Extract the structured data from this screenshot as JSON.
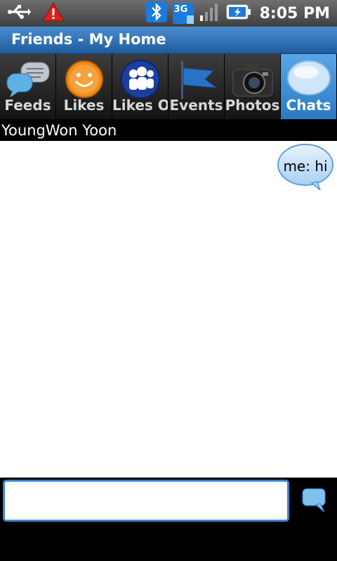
{
  "status_bar": {
    "time": "8:05 PM",
    "network_badge": "3G",
    "icons": [
      "usb-icon",
      "warning-icon",
      "bluetooth-icon",
      "network-3g-icon",
      "signal-icon",
      "battery-charging-icon"
    ]
  },
  "app": {
    "title": "Friends - My Home"
  },
  "tabs": [
    {
      "label": "Feeds",
      "icon": "speech-bubbles-icon"
    },
    {
      "label": "Likes",
      "icon": "smiley-icon"
    },
    {
      "label": "Likes Ot",
      "icon": "myspace-icon"
    },
    {
      "label": "Events",
      "icon": "flag-icon"
    },
    {
      "label": "Photos",
      "icon": "camera-icon"
    },
    {
      "label": "Chats",
      "icon": "chat-bubble-icon",
      "active": true
    }
  ],
  "chat": {
    "contact_name": "YoungWon Yoon",
    "messages": [
      {
        "text": "me: hi",
        "from": "me"
      }
    ]
  },
  "composer": {
    "value": "",
    "placeholder": ""
  },
  "colors": {
    "accent_blue": "#3a86d6",
    "title_bar": "#2f6fb3",
    "active_tab": "#3d8bd6"
  }
}
